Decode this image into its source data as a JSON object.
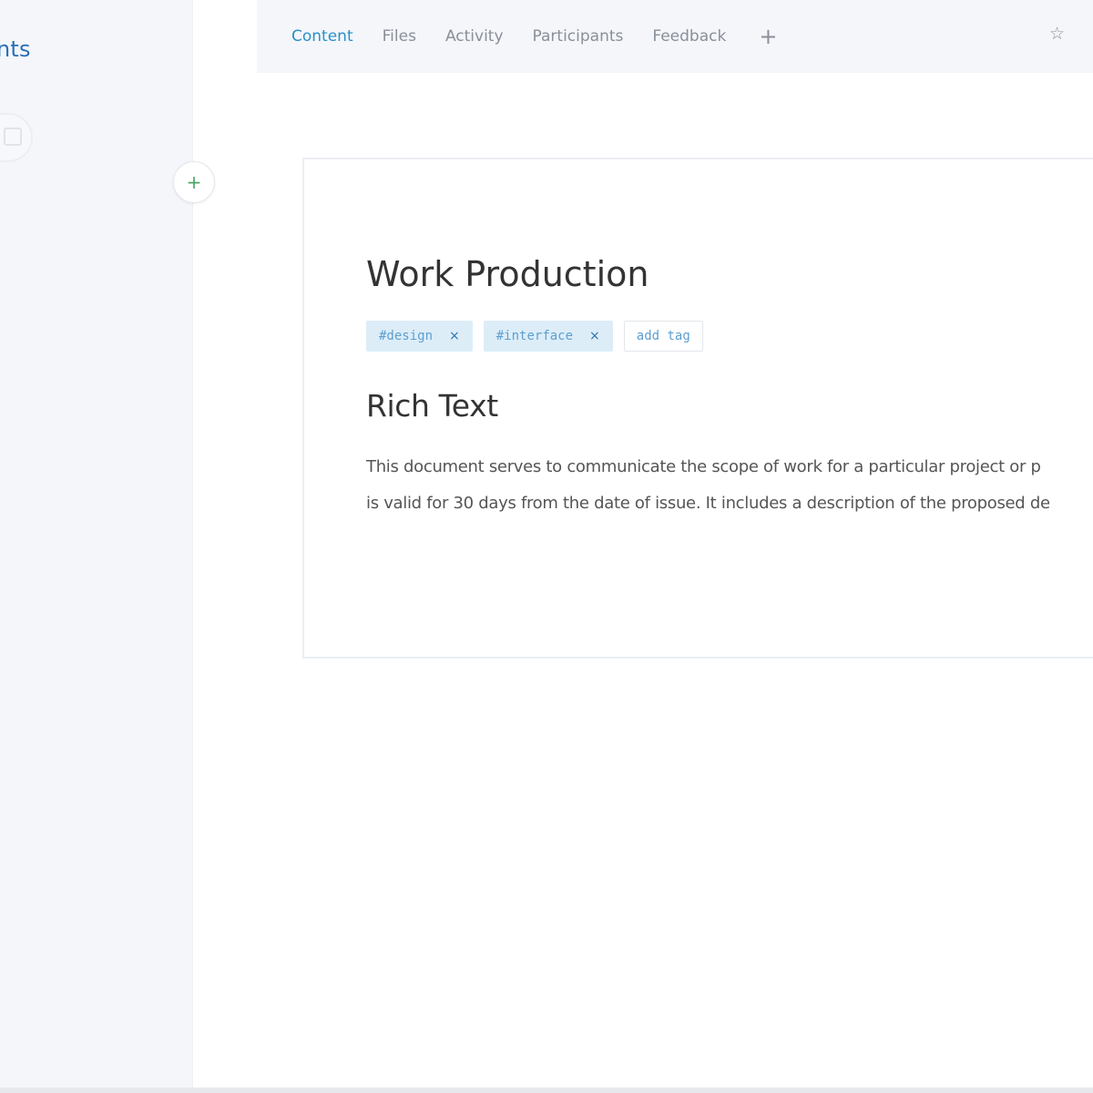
{
  "sidebar": {
    "title_fragment": "nts"
  },
  "tabs": [
    {
      "label": "Content",
      "active": true
    },
    {
      "label": "Files",
      "active": false
    },
    {
      "label": "Activity",
      "active": false
    },
    {
      "label": "Participants",
      "active": false
    },
    {
      "label": "Feedback",
      "active": false
    }
  ],
  "tab_add_glyph": "+",
  "star_glyph": "☆",
  "add_section_glyph": "+",
  "document": {
    "title": "Work Production",
    "tags": [
      {
        "label": "#design",
        "remove_glyph": "×"
      },
      {
        "label": "#interface",
        "remove_glyph": "×"
      }
    ],
    "add_tag_label": "add tag",
    "section_heading": "Rich Text",
    "body_lines": [
      "This document serves to communicate the scope of work for a particular project or p",
      "is valid for 30 days from the date of issue. It includes a description of the proposed de"
    ]
  },
  "colors": {
    "accent": "#2a8fc7",
    "tag_bg": "#dcedf8",
    "sidebar_bg": "#f4f6fa",
    "add_icon": "#4aa564"
  }
}
